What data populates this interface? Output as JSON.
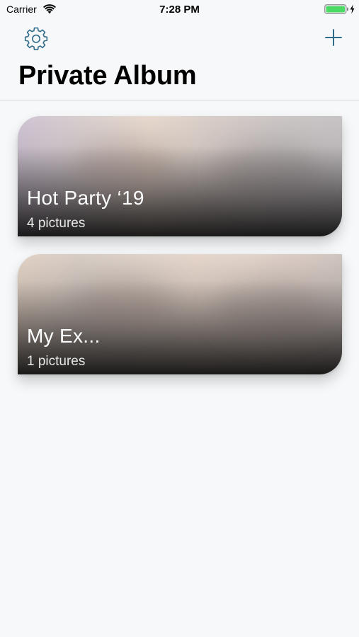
{
  "status_bar": {
    "carrier": "Carrier",
    "time": "7:28 PM"
  },
  "nav": {
    "title": "Private Album",
    "settings_icon": "gear-icon",
    "add_icon": "plus-icon",
    "accent_color": "#2f6b8a"
  },
  "albums": [
    {
      "name": "Hot Party ‘19",
      "count": "4 pictures"
    },
    {
      "name": "My Ex...",
      "count": "1 pictures"
    }
  ]
}
